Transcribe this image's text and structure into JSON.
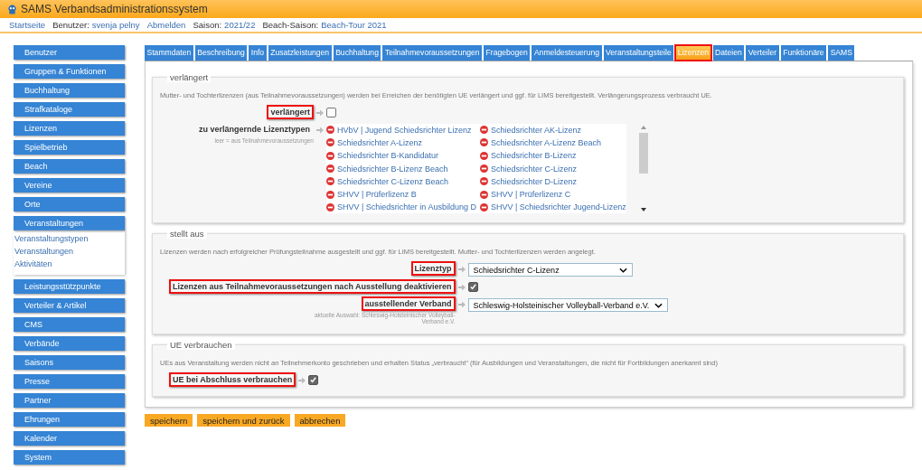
{
  "app": {
    "title": "SAMS Verbandsadministrationssystem"
  },
  "nav": [
    {
      "kind": "link",
      "text": "Startseite"
    },
    {
      "kind": "label",
      "text": "Benutzer:"
    },
    {
      "kind": "link",
      "text": "svenja pelny"
    },
    {
      "kind": "link",
      "text": "Abmelden"
    },
    {
      "kind": "label",
      "text": "Saison:"
    },
    {
      "kind": "link",
      "text": "2021/22"
    },
    {
      "kind": "label",
      "text": "Beach-Saison:"
    },
    {
      "kind": "link",
      "text": "Beach-Tour 2021"
    }
  ],
  "sidebar": [
    {
      "label": "Benutzer"
    },
    {
      "label": "Gruppen & Funktionen"
    },
    {
      "label": "Buchhaltung"
    },
    {
      "label": "Strafkataloge"
    },
    {
      "label": "Lizenzen"
    },
    {
      "label": "Spielbetrieb"
    },
    {
      "label": "Beach"
    },
    {
      "label": "Vereine"
    },
    {
      "label": "Orte"
    },
    {
      "label": "Veranstaltungen",
      "children": [
        "Veranstaltungstypen",
        "Veranstaltungen",
        "Aktivitäten"
      ]
    },
    {
      "label": "Leistungsstützpunkte"
    },
    {
      "label": "Verteiler & Artikel"
    },
    {
      "label": "CMS"
    },
    {
      "label": "Verbände"
    },
    {
      "label": "Saisons"
    },
    {
      "label": "Presse"
    },
    {
      "label": "Partner"
    },
    {
      "label": "Ehrungen"
    },
    {
      "label": "Kalender"
    },
    {
      "label": "System"
    }
  ],
  "tabs": [
    {
      "label": "Stammdaten",
      "selected": false,
      "highlighted": false
    },
    {
      "label": "Beschreibung",
      "selected": false,
      "highlighted": false
    },
    {
      "label": "Info",
      "selected": false,
      "highlighted": false
    },
    {
      "label": "Zusatzleistungen",
      "selected": false,
      "highlighted": false
    },
    {
      "label": "Buchhaltung",
      "selected": false,
      "highlighted": false
    },
    {
      "label": "Teilnahmevoraussetzungen",
      "selected": false,
      "highlighted": false
    },
    {
      "label": "Fragebogen",
      "selected": false,
      "highlighted": false
    },
    {
      "label": "Anmeldesteuerung",
      "selected": false,
      "highlighted": false
    },
    {
      "label": "Veranstaltungsteile",
      "selected": false,
      "highlighted": false
    },
    {
      "label": "Lizenzen",
      "selected": true,
      "highlighted": true
    },
    {
      "label": "Dateien",
      "selected": false,
      "highlighted": false
    },
    {
      "label": "Verteiler",
      "selected": false,
      "highlighted": false
    },
    {
      "label": "Funktionäre",
      "selected": false,
      "highlighted": false
    },
    {
      "label": "SAMS",
      "selected": false,
      "highlighted": false
    }
  ],
  "sections": [
    {
      "legend": "verlängert",
      "description": "Mutter- und Tochterlizenzen (aus Teilnahmevoraussetzungen) werden bei Erreichen der benötigten UE verlängert und ggf. für LIMS bereitgestellt. Verlängerungsprozess verbraucht UE.",
      "fields": [
        {
          "kind": "checkbox",
          "label": "verlängert",
          "highlighted": true,
          "checked": false
        },
        {
          "kind": "list",
          "label": "zu verlängernde Lizenztypen",
          "hint": "leer = aus Teilnahmevoraussetzungen",
          "highlighted": false,
          "items": [
            "HVbV | Jugend Schiedsrichter Lizenz",
            "Schiedsrichter AK-Lizenz",
            "Schiedsrichter A-Lizenz",
            "Schiedsrichter A-Lizenz Beach",
            "Schiedsrichter B-Kandidatur",
            "Schiedsrichter B-Lizenz",
            "Schiedsrichter B-Lizenz Beach",
            "Schiedsrichter C-Lizenz",
            "Schiedsrichter C-Lizenz Beach",
            "Schiedsrichter D-Lizenz",
            "SHVV | Prüferlizenz B",
            "SHVV | Prüferlizenz C",
            "SHVV | Schiedsrichter in Ausbildung D",
            "SHVV | Schiedsrichter Jugend-Lizenz"
          ]
        }
      ]
    },
    {
      "legend": "stellt aus",
      "description": "Lizenzen werden nach erfolgreicher Prüfungsteilnahme ausgestellt und ggf. für LIMS bereitgestellt. Mutter- und Tochterlizenzen werden angelegt.",
      "fields": [
        {
          "kind": "select",
          "label": "Lizenztyp",
          "highlighted": true,
          "value": "Schiedsrichter C-Lizenz"
        },
        {
          "kind": "checkbox",
          "label": "Lizenzen aus Teilnahmevoraussetzungen nach Ausstellung deaktivieren",
          "highlighted": true,
          "checked": true
        },
        {
          "kind": "select",
          "label": "ausstellender Verband",
          "hint": "aktuelle Auswahl: Schleswig-Holsteinischer Volleyball-Verband e.V.",
          "highlighted": true,
          "value": "Schleswig-Holsteinischer Volleyball-Verband e.V."
        }
      ]
    },
    {
      "legend": "UE verbrauchen",
      "description": "UEs aus Veranstaltung werden nicht an Teilnehmerkonto geschrieben und erhalten Status „verbraucht“ (für Ausbildungen und Veranstaltungen, die nicht für Fortbildungen anerkannt sind)",
      "fields": [
        {
          "kind": "checkbox",
          "label": "UE bei Abschluss verbrauchen",
          "highlighted": true,
          "checked": true
        }
      ]
    }
  ],
  "buttons": [
    "speichern",
    "speichern und zurück",
    "abbrechen"
  ]
}
